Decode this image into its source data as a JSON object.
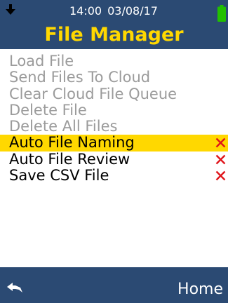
{
  "status": {
    "time": "14:00",
    "date": "03/08/17",
    "download_icon": "download-arrow-icon",
    "battery_icon": "battery-full-icon",
    "battery_color": "#22c000"
  },
  "header": {
    "title": "File Manager",
    "title_color": "#ffd800",
    "background": "#2b4a73"
  },
  "menu": {
    "items": [
      {
        "label": "Load File",
        "state": "disabled"
      },
      {
        "label": "Send Files To Cloud",
        "state": "disabled"
      },
      {
        "label": "Clear Cloud File Queue",
        "state": "disabled"
      },
      {
        "label": "Delete File",
        "state": "disabled"
      },
      {
        "label": "Delete All Files",
        "state": "disabled"
      },
      {
        "label": "Auto File Naming",
        "state": "selected",
        "toggle": "off",
        "toggle_icon": "x-icon"
      },
      {
        "label": "Auto File Review",
        "state": "enabled",
        "toggle": "off",
        "toggle_icon": "x-icon"
      },
      {
        "label": "Save CSV File",
        "state": "enabled",
        "toggle": "off",
        "toggle_icon": "x-icon"
      }
    ],
    "selection_color": "#ffd800",
    "disabled_color": "#9b9b9b",
    "x_color": "#e0141a"
  },
  "footer": {
    "back_icon": "back-arrow-icon",
    "home_label": "Home"
  }
}
